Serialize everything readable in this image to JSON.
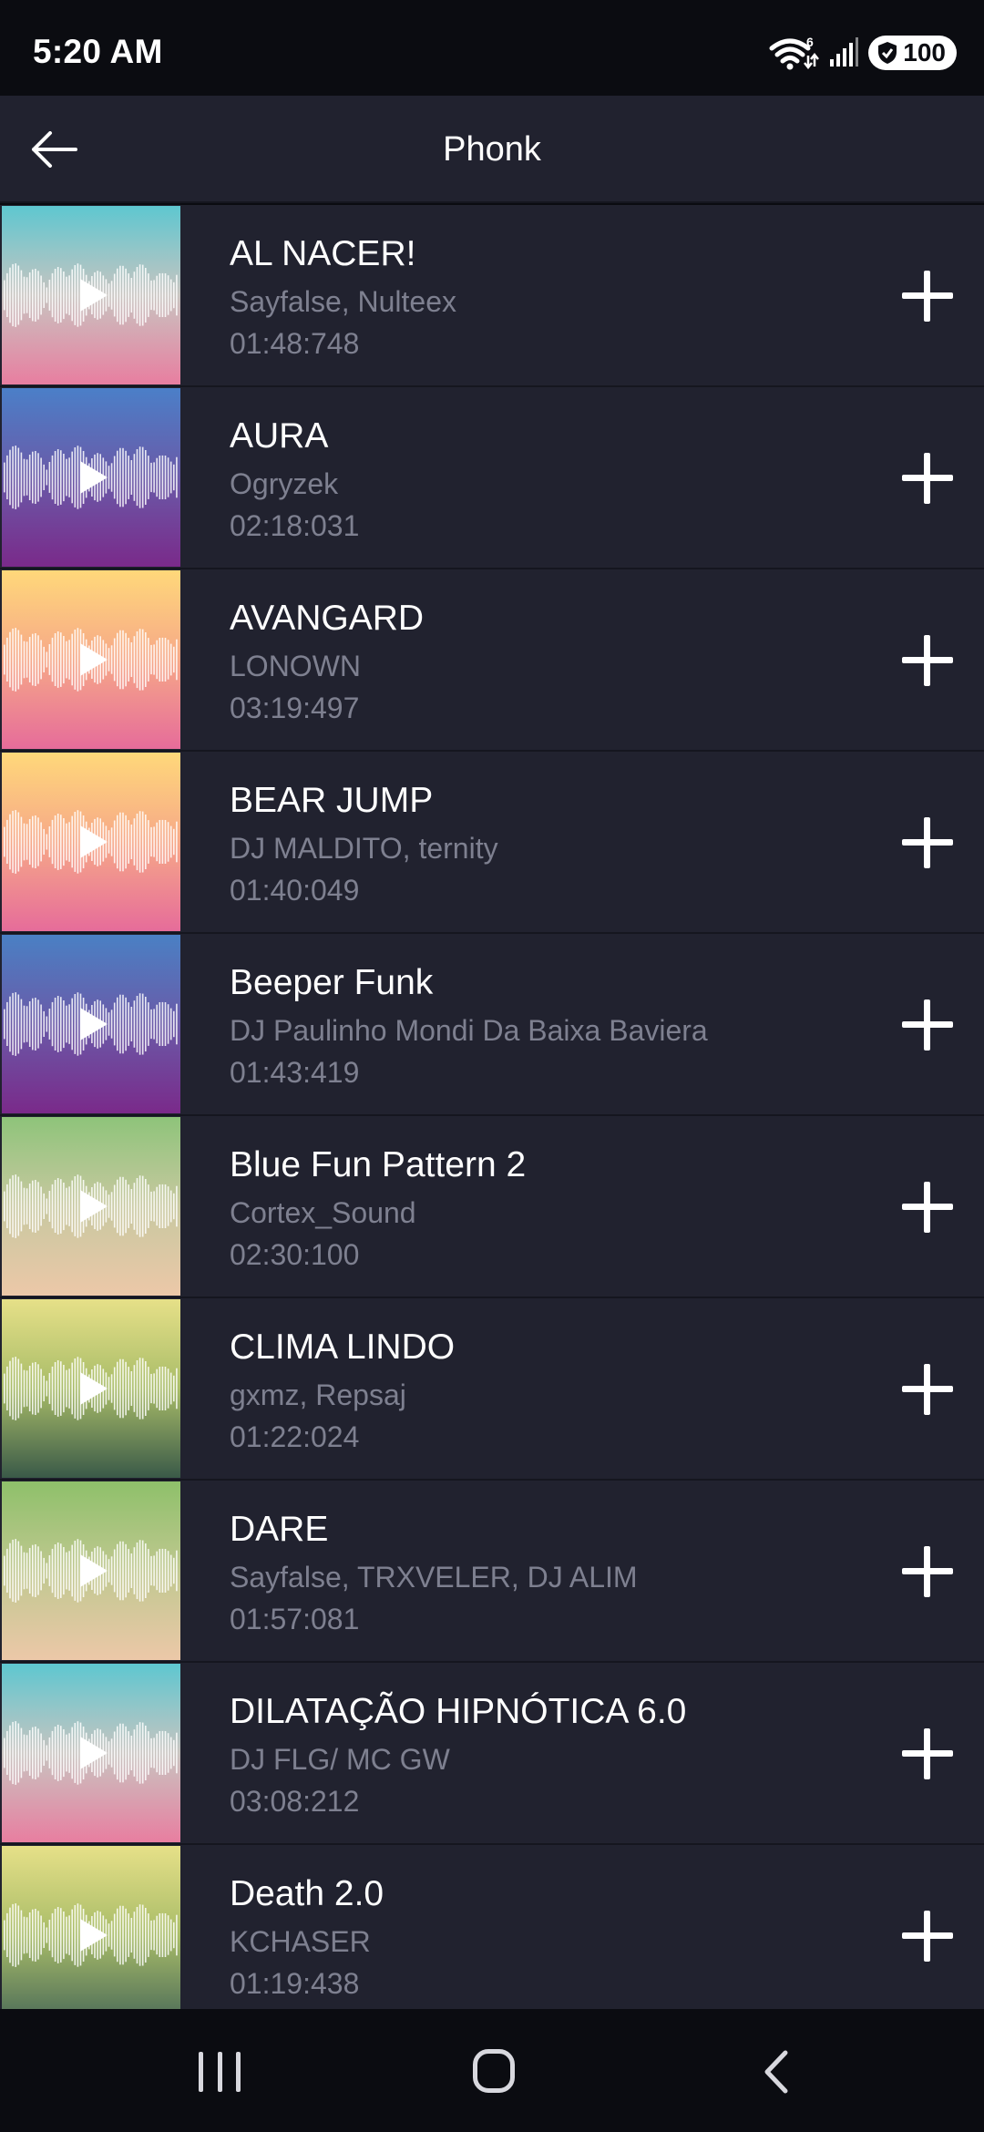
{
  "status_bar": {
    "time": "5:20 AM",
    "wifi_badge": "6",
    "battery": "100"
  },
  "header": {
    "title": "Phonk",
    "back_icon": "back-arrow-icon"
  },
  "tracks": [
    {
      "title": "AL NACER!",
      "artist": "Sayfalse, Nulteex",
      "duration": "01:48:748",
      "colors": [
        "#5ec7d0",
        "#c8c4c0",
        "#e87ea0"
      ]
    },
    {
      "title": "AURA",
      "artist": "Ogryzek",
      "duration": "02:18:031",
      "colors": [
        "#4b7fc8",
        "#6a5aa8",
        "#7a2a8a"
      ]
    },
    {
      "title": "AVANGARD",
      "artist": "LONOWN",
      "duration": "03:19:497",
      "colors": [
        "#ffd87a",
        "#f6a888",
        "#e66c9a"
      ]
    },
    {
      "title": "BEAR JUMP",
      "artist": "DJ MALDITO, ternity",
      "duration": "01:40:049",
      "colors": [
        "#ffd87a",
        "#f6a888",
        "#e66c9a"
      ]
    },
    {
      "title": "Beeper Funk",
      "artist": "DJ Paulinho Mondi Da Baixa Baviera",
      "duration": "01:43:419",
      "colors": [
        "#4a80c4",
        "#6a5aa8",
        "#7a2a8a"
      ]
    },
    {
      "title": "Blue Fun Pattern 2",
      "artist": "Cortex_Sound",
      "duration": "02:30:100",
      "colors": [
        "#8ec47a",
        "#c8c8a0",
        "#ecc8a8"
      ]
    },
    {
      "title": "CLIMA LINDO",
      "artist": "gxmz, Repsaj",
      "duration": "01:22:024",
      "colors": [
        "#e6e088",
        "#a8bc68",
        "#3a5a48"
      ]
    },
    {
      "title": "DARE",
      "artist": "Sayfalse, TRXVELER, DJ ALIM",
      "duration": "01:57:081",
      "colors": [
        "#8ec06a",
        "#c0c890",
        "#ecc8a8"
      ]
    },
    {
      "title": "DILATAÇÃO HIPNÓTICA 6.0",
      "artist": "DJ FLG/ MC GW",
      "duration": "03:08:212",
      "colors": [
        "#5ec7d0",
        "#c8c4c0",
        "#e87ea0"
      ]
    },
    {
      "title": "Death 2.0",
      "artist": "KCHASER",
      "duration": "01:19:438",
      "colors": [
        "#e6e088",
        "#a8bc68",
        "#4a6a58"
      ]
    }
  ],
  "nav": {
    "recents": "recents-icon",
    "home": "home-icon",
    "back": "nav-back-icon"
  }
}
